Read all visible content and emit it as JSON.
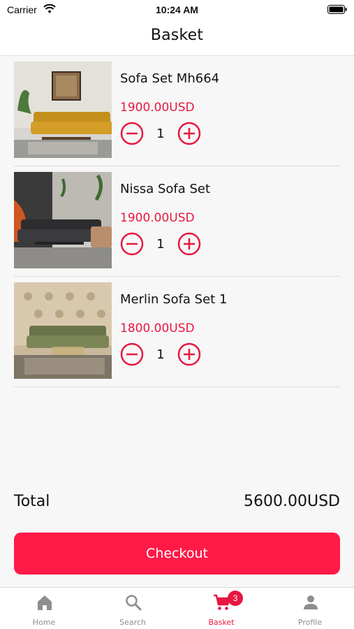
{
  "status_bar": {
    "carrier": "Carrier",
    "time": "10:24 AM"
  },
  "header": {
    "title": "Basket"
  },
  "items": [
    {
      "name": "Sofa Set Mh664",
      "price": "1900.00USD",
      "quantity": "1",
      "image": "sofa-mustard-image"
    },
    {
      "name": "Nissa Sofa Set",
      "price": "1900.00USD",
      "quantity": "1",
      "image": "sofa-dark-grey-image"
    },
    {
      "name": "Merlin Sofa Set 1",
      "price": "1800.00USD",
      "quantity": "1",
      "image": "sofa-olive-image"
    }
  ],
  "summary": {
    "total_label": "Total",
    "total_value": "5600.00USD"
  },
  "checkout": {
    "label": "Checkout"
  },
  "tab_bar": {
    "tabs": [
      {
        "label": "Home",
        "icon": "home-icon"
      },
      {
        "label": "Search",
        "icon": "search-icon"
      },
      {
        "label": "Basket",
        "icon": "cart-icon",
        "badge": "3",
        "active": true
      },
      {
        "label": "Profile",
        "icon": "person-icon"
      }
    ]
  },
  "colors": {
    "accent": "#e8173f",
    "button": "#ff1a47",
    "background": "#f7f7f7"
  }
}
